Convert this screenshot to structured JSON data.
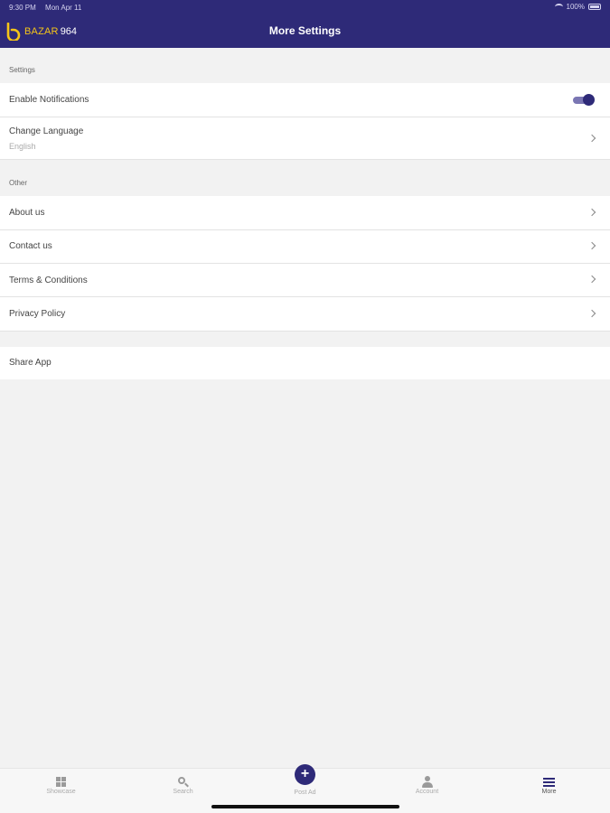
{
  "status": {
    "time": "9:30 PM",
    "date": "Mon Apr 11",
    "battery": "100%"
  },
  "header": {
    "logo_letter": "b",
    "logo_text": "BAZAR",
    "logo_num": "964",
    "title": "More Settings"
  },
  "sections": {
    "settings_header": "Settings",
    "other_header": "Other"
  },
  "settings": {
    "notifications_label": "Enable Notifications",
    "notifications_enabled": true,
    "language_label": "Change Language",
    "language_value": "English"
  },
  "other": {
    "about_label": "About us",
    "contact_label": "Contact us",
    "terms_label": "Terms & Conditions",
    "privacy_label": "Privacy Policy"
  },
  "share": {
    "label": "Share App"
  },
  "tabbar": {
    "showcase": "Showcase",
    "search": "Search",
    "post_ad": "Post Ad",
    "account": "Account",
    "more": "More"
  },
  "colors": {
    "brand": "#2e2a78",
    "accent": "#f5c518",
    "background": "#f2f2f2"
  },
  "icons": {
    "showcase": "grid-icon",
    "search": "search-icon",
    "post_ad": "plus-icon",
    "account": "user-icon",
    "more": "menu-icon",
    "row_disclosure": "chevron-right-icon"
  }
}
